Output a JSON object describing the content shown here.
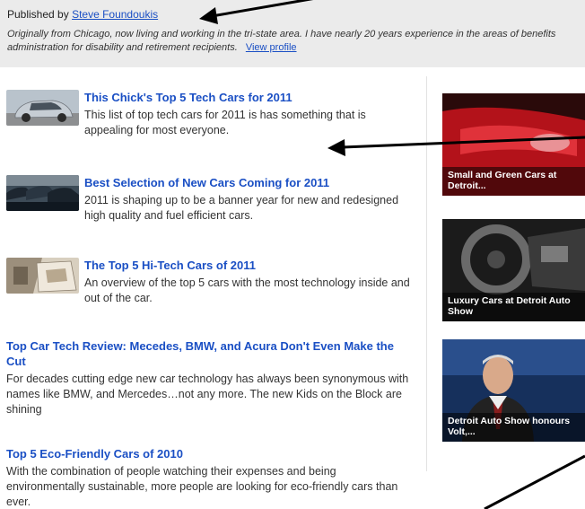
{
  "author": {
    "published_by": "Published by",
    "name": "Steve Foundoukis",
    "bio": "Originally from Chicago, now living and working in the tri-state area. I have nearly 20 years experience in the areas of benefits administration for disability and retirement recipients.",
    "view_profile": "View profile"
  },
  "articles": [
    {
      "title": "This Chick's Top 5 Tech Cars for 2011",
      "desc": "This list of top tech cars for 2011 is has something that is appealing for most everyone."
    },
    {
      "title": "Best Selection of New Cars Coming for 2011",
      "desc": "2011 is shaping up to be a banner year for new and redesigned high quality and fuel efficient cars."
    },
    {
      "title": "The Top 5 Hi-Tech Cars of 2011",
      "desc": "An overview of the top 5 cars with the most technology inside and out of the car."
    },
    {
      "title": "Top Car Tech Review: Mecedes, BMW, and Acura Don't Even Make the Cut",
      "desc": "For decades cutting edge new car technology has always been synonymous with names like BMW, and Mercedes…not any more. The new Kids on the Block are shining"
    },
    {
      "title": "Top 5 Eco-Friendly Cars of 2010",
      "desc": "With the combination of people watching their expenses and being environmentally sustainable, more people are looking for eco-friendly cars than ever."
    }
  ],
  "videos": [
    {
      "caption": "Small and Green Cars at Detroit..."
    },
    {
      "caption": "Luxury Cars at Detroit Auto Show"
    },
    {
      "caption": "Detroit Auto Show honours Volt,..."
    }
  ],
  "colors": {
    "link": "#1a4fc4",
    "author_bg": "#ebebeb",
    "annotation_arrow": "#000000"
  }
}
